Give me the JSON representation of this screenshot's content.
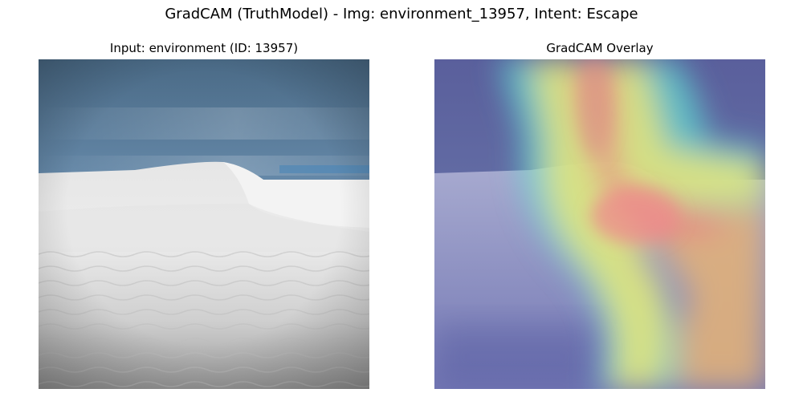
{
  "figure": {
    "suptitle": "GradCAM (TruthModel) - Img: environment_13957, Intent: Escape"
  },
  "panels": [
    {
      "title": "Input: environment (ID: 13957)",
      "image": "sand-dune-photo"
    },
    {
      "title": "GradCAM Overlay",
      "image": "gradcam-heatmap-overlay"
    }
  ],
  "colors": {
    "sky": "#6a8fb0",
    "sand": "#e6e6e6",
    "heat_high": "#e88a8a",
    "heat_mid": "#e8e680",
    "heat_low": "#5a63c0"
  }
}
